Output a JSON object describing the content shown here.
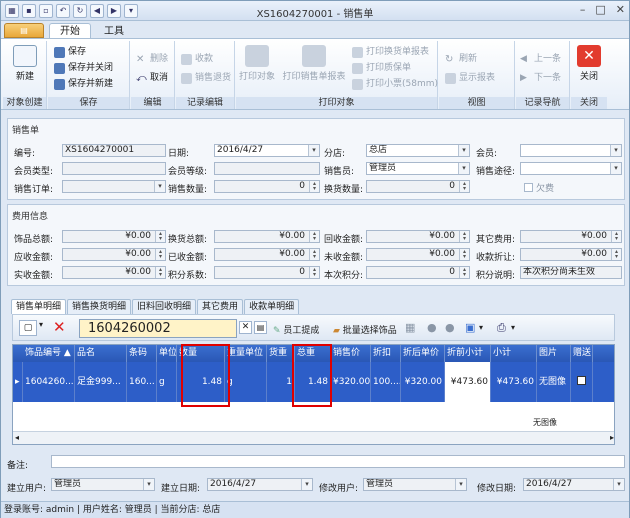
{
  "window": {
    "title": "XS1604270001 - 销售单"
  },
  "ribbon": {
    "app_tab": "▤",
    "tabs": [
      {
        "label": "开始"
      },
      {
        "label": "工具"
      }
    ],
    "groups": {
      "create": {
        "label": "对象创建",
        "new": "新建"
      },
      "save": {
        "label": "保存",
        "save": "保存",
        "save_close": "保存并关闭",
        "save_new": "保存并新建"
      },
      "edit": {
        "label": "编辑",
        "delete": "删除",
        "cancel": "取消"
      },
      "record": {
        "label": "记录编辑",
        "collect": "收款",
        "refund": "销售退货"
      },
      "print": {
        "label": "打印对象",
        "print_obj": "打印对象",
        "print_sale": "打印销售单报表",
        "print_exchange": "打印换货单报表",
        "print_guarantee": "打印质保单",
        "print_ticket": "打印小票(58mm)"
      },
      "view": {
        "label": "视图",
        "refresh": "刷新",
        "show_report": "显示报表"
      },
      "nav": {
        "label": "记录导航",
        "prev": "上一条",
        "next": "下一条"
      },
      "close": {
        "label": "关闭",
        "close": "关闭"
      }
    }
  },
  "form": {
    "section_title": "销售单",
    "number_label": "编号:",
    "number": "XS1604270001",
    "date_label": "日期:",
    "date": "2016/4/27",
    "store_label": "分店:",
    "store": "总店",
    "member_label": "会员:",
    "member": "",
    "member_type_label": "会员类型:",
    "member_level_label": "会员等级:",
    "clerk_label": "销售员:",
    "clerk": "管理员",
    "channel_label": "销售途径:",
    "order_label": "销售订单:",
    "qty_label": "销售数量:",
    "qty": "0",
    "exchange_qty_label": "换货数量:",
    "exchange_qty": "0",
    "owed_label": "欠费"
  },
  "fees": {
    "section_title": "费用信息",
    "rows": [
      [
        {
          "label": "饰品总额:",
          "value": "¥0.00"
        },
        {
          "label": "换货总额:",
          "value": "¥0.00"
        },
        {
          "label": "回收金额:",
          "value": "¥0.00"
        },
        {
          "label": "其它费用:",
          "value": "¥0.00"
        }
      ],
      [
        {
          "label": "应收金额:",
          "value": "¥0.00"
        },
        {
          "label": "已收金额:",
          "value": "¥0.00"
        },
        {
          "label": "未收金额:",
          "value": "¥0.00"
        },
        {
          "label": "收款折让:",
          "value": "¥0.00"
        }
      ],
      [
        {
          "label": "实收金额:",
          "value": "¥0.00"
        },
        {
          "label": "积分系数:",
          "value": "0"
        },
        {
          "label": "本次积分:",
          "value": "0"
        },
        {
          "label": "积分说明:",
          "value": "本次积分尚未生效"
        }
      ]
    ]
  },
  "detail_tabs": [
    {
      "label": "销售单明细"
    },
    {
      "label": "销售换货明细"
    },
    {
      "label": "旧料回收明细"
    },
    {
      "label": "其它费用"
    },
    {
      "label": "收款单明细"
    }
  ],
  "toolbar2": {
    "code": "1604260002",
    "staff_pick": "员工提成",
    "batch_pick": "批量选择饰品"
  },
  "grid": {
    "headers": [
      "饰品编号 ▲",
      "品名",
      "条码",
      "单位",
      "数量",
      "重量单位",
      "货重",
      "总重",
      "销售价",
      "折扣",
      "折后单价",
      "折前小计",
      "小计",
      "图片",
      "赠送"
    ],
    "rows": [
      [
        "1604260...",
        "足金999...",
        "160...",
        "g",
        "1.48",
        "g",
        "1",
        "1.48",
        "¥320.00",
        "100....",
        "¥320.00",
        "¥473.60",
        "¥473.60",
        "无图像",
        ""
      ]
    ],
    "second_row_image": "无图像"
  },
  "footer": {
    "remark_label": "备注:",
    "creator_label": "建立用户:",
    "creator": "管理员",
    "created_label": "建立日期:",
    "created": "2016/4/27",
    "modifier_label": "修改用户:",
    "modifier": "管理员",
    "modified_label": "修改日期:",
    "modified": "2016/4/27"
  },
  "status": {
    "text": "登录账号: admin  |  用户姓名: 管理员  |  当前分店: 总店"
  }
}
